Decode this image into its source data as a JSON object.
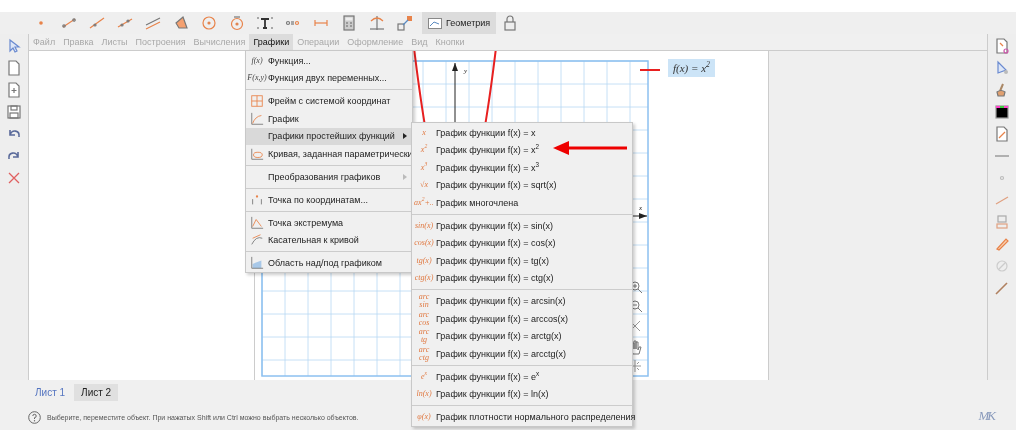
{
  "toolbar": {
    "mode_button": {
      "label": "Геометрия"
    }
  },
  "menu_bar": {
    "items": [
      {
        "label": "Файл",
        "selected": false
      },
      {
        "label": "Правка",
        "selected": false
      },
      {
        "label": "Листы",
        "selected": false
      },
      {
        "label": "Построения",
        "selected": false
      },
      {
        "label": "Вычисления",
        "selected": false
      },
      {
        "label": "Графики",
        "selected": true
      },
      {
        "label": "Операции",
        "selected": false
      },
      {
        "label": "Оформление",
        "selected": false
      },
      {
        "label": "Вид",
        "selected": false
      },
      {
        "label": "Кнопки",
        "selected": false
      }
    ]
  },
  "graphics_menu": {
    "groups": [
      [
        {
          "glyph": "f(x)",
          "label": "Функция...",
          "selected": false,
          "has_submenu": false
        },
        {
          "glyph": "F(x,y)",
          "label": "Функция двух переменных...",
          "selected": false,
          "has_submenu": false
        }
      ],
      [
        {
          "label": "Фрейм с системой координат",
          "selected": false,
          "has_submenu": false
        },
        {
          "label": "График",
          "selected": false,
          "has_submenu": false
        },
        {
          "label": "Графики простейших функций",
          "selected": true,
          "has_submenu": true
        },
        {
          "label": "Кривая, заданная параметрически",
          "selected": false,
          "has_submenu": false
        }
      ],
      [
        {
          "label": "Преобразования графиков",
          "selected": false,
          "has_submenu": true
        }
      ],
      [
        {
          "label": "Точка по координатам...",
          "selected": false,
          "has_submenu": false
        }
      ],
      [
        {
          "label": "Точка экстремума",
          "selected": false,
          "has_submenu": false
        },
        {
          "label": "Касательная к кривой",
          "selected": false,
          "has_submenu": false
        }
      ],
      [
        {
          "label": "Область над/под графиком",
          "selected": false,
          "has_submenu": false
        }
      ]
    ]
  },
  "functions_submenu": {
    "groups": [
      [
        {
          "glyph": "x",
          "label": "График функции f(x) = x"
        },
        {
          "glyph": "x$^{2}$",
          "label": "График функции f(x) = x$^{2}$"
        },
        {
          "glyph": "x$^{3}$",
          "label": "График функции f(x) = x$^{3}$"
        },
        {
          "glyph": "√x",
          "label": "График функции f(x) = sqrt(x)"
        },
        {
          "glyph": "ax$^{2}$+..",
          "label": "График многочлена"
        }
      ],
      [
        {
          "glyph": "sin(x)",
          "label": "График функции f(x) = sin(x)"
        },
        {
          "glyph": "cos(x)",
          "label": "График функции f(x) = cos(x)"
        },
        {
          "glyph": "tg(x)",
          "label": "График функции f(x) = tg(x)"
        },
        {
          "glyph": "ctg(x)",
          "label": "График функции f(x) = ctg(x)"
        }
      ],
      [
        {
          "glyph": "arc\nsin",
          "label": "График функции f(x) = arcsin(x)"
        },
        {
          "glyph": "arc\ncos",
          "label": "График функции f(x) = arccos(x)"
        },
        {
          "glyph": "arc\ntg",
          "label": "График функции f(x) = arctg(x)"
        },
        {
          "glyph": "arc\nctg",
          "label": "График функции f(x) = arcctg(x)"
        }
      ],
      [
        {
          "glyph": "e$^{x}$",
          "label": "График функции f(x) = e$^{x}$"
        },
        {
          "glyph": "ln(x)",
          "label": "График функции f(x) = ln(x)"
        }
      ],
      [
        {
          "glyph": "φ(x)",
          "label": "График плотности нормального распределения"
        }
      ]
    ]
  },
  "canvas": {
    "y_axis_label": "y",
    "x_axis_label": "x",
    "legend": "f(x) = x$^{2}$"
  },
  "sheet_tabs": [
    {
      "label": "Лист 1",
      "selected": false
    },
    {
      "label": "Лист 2",
      "selected": true
    }
  ],
  "status_bar": {
    "text": "Выберите, переместите объект. При нажатых Shift или Ctrl можно выбрать несколько объектов."
  },
  "logo": {
    "text": "MK"
  }
}
